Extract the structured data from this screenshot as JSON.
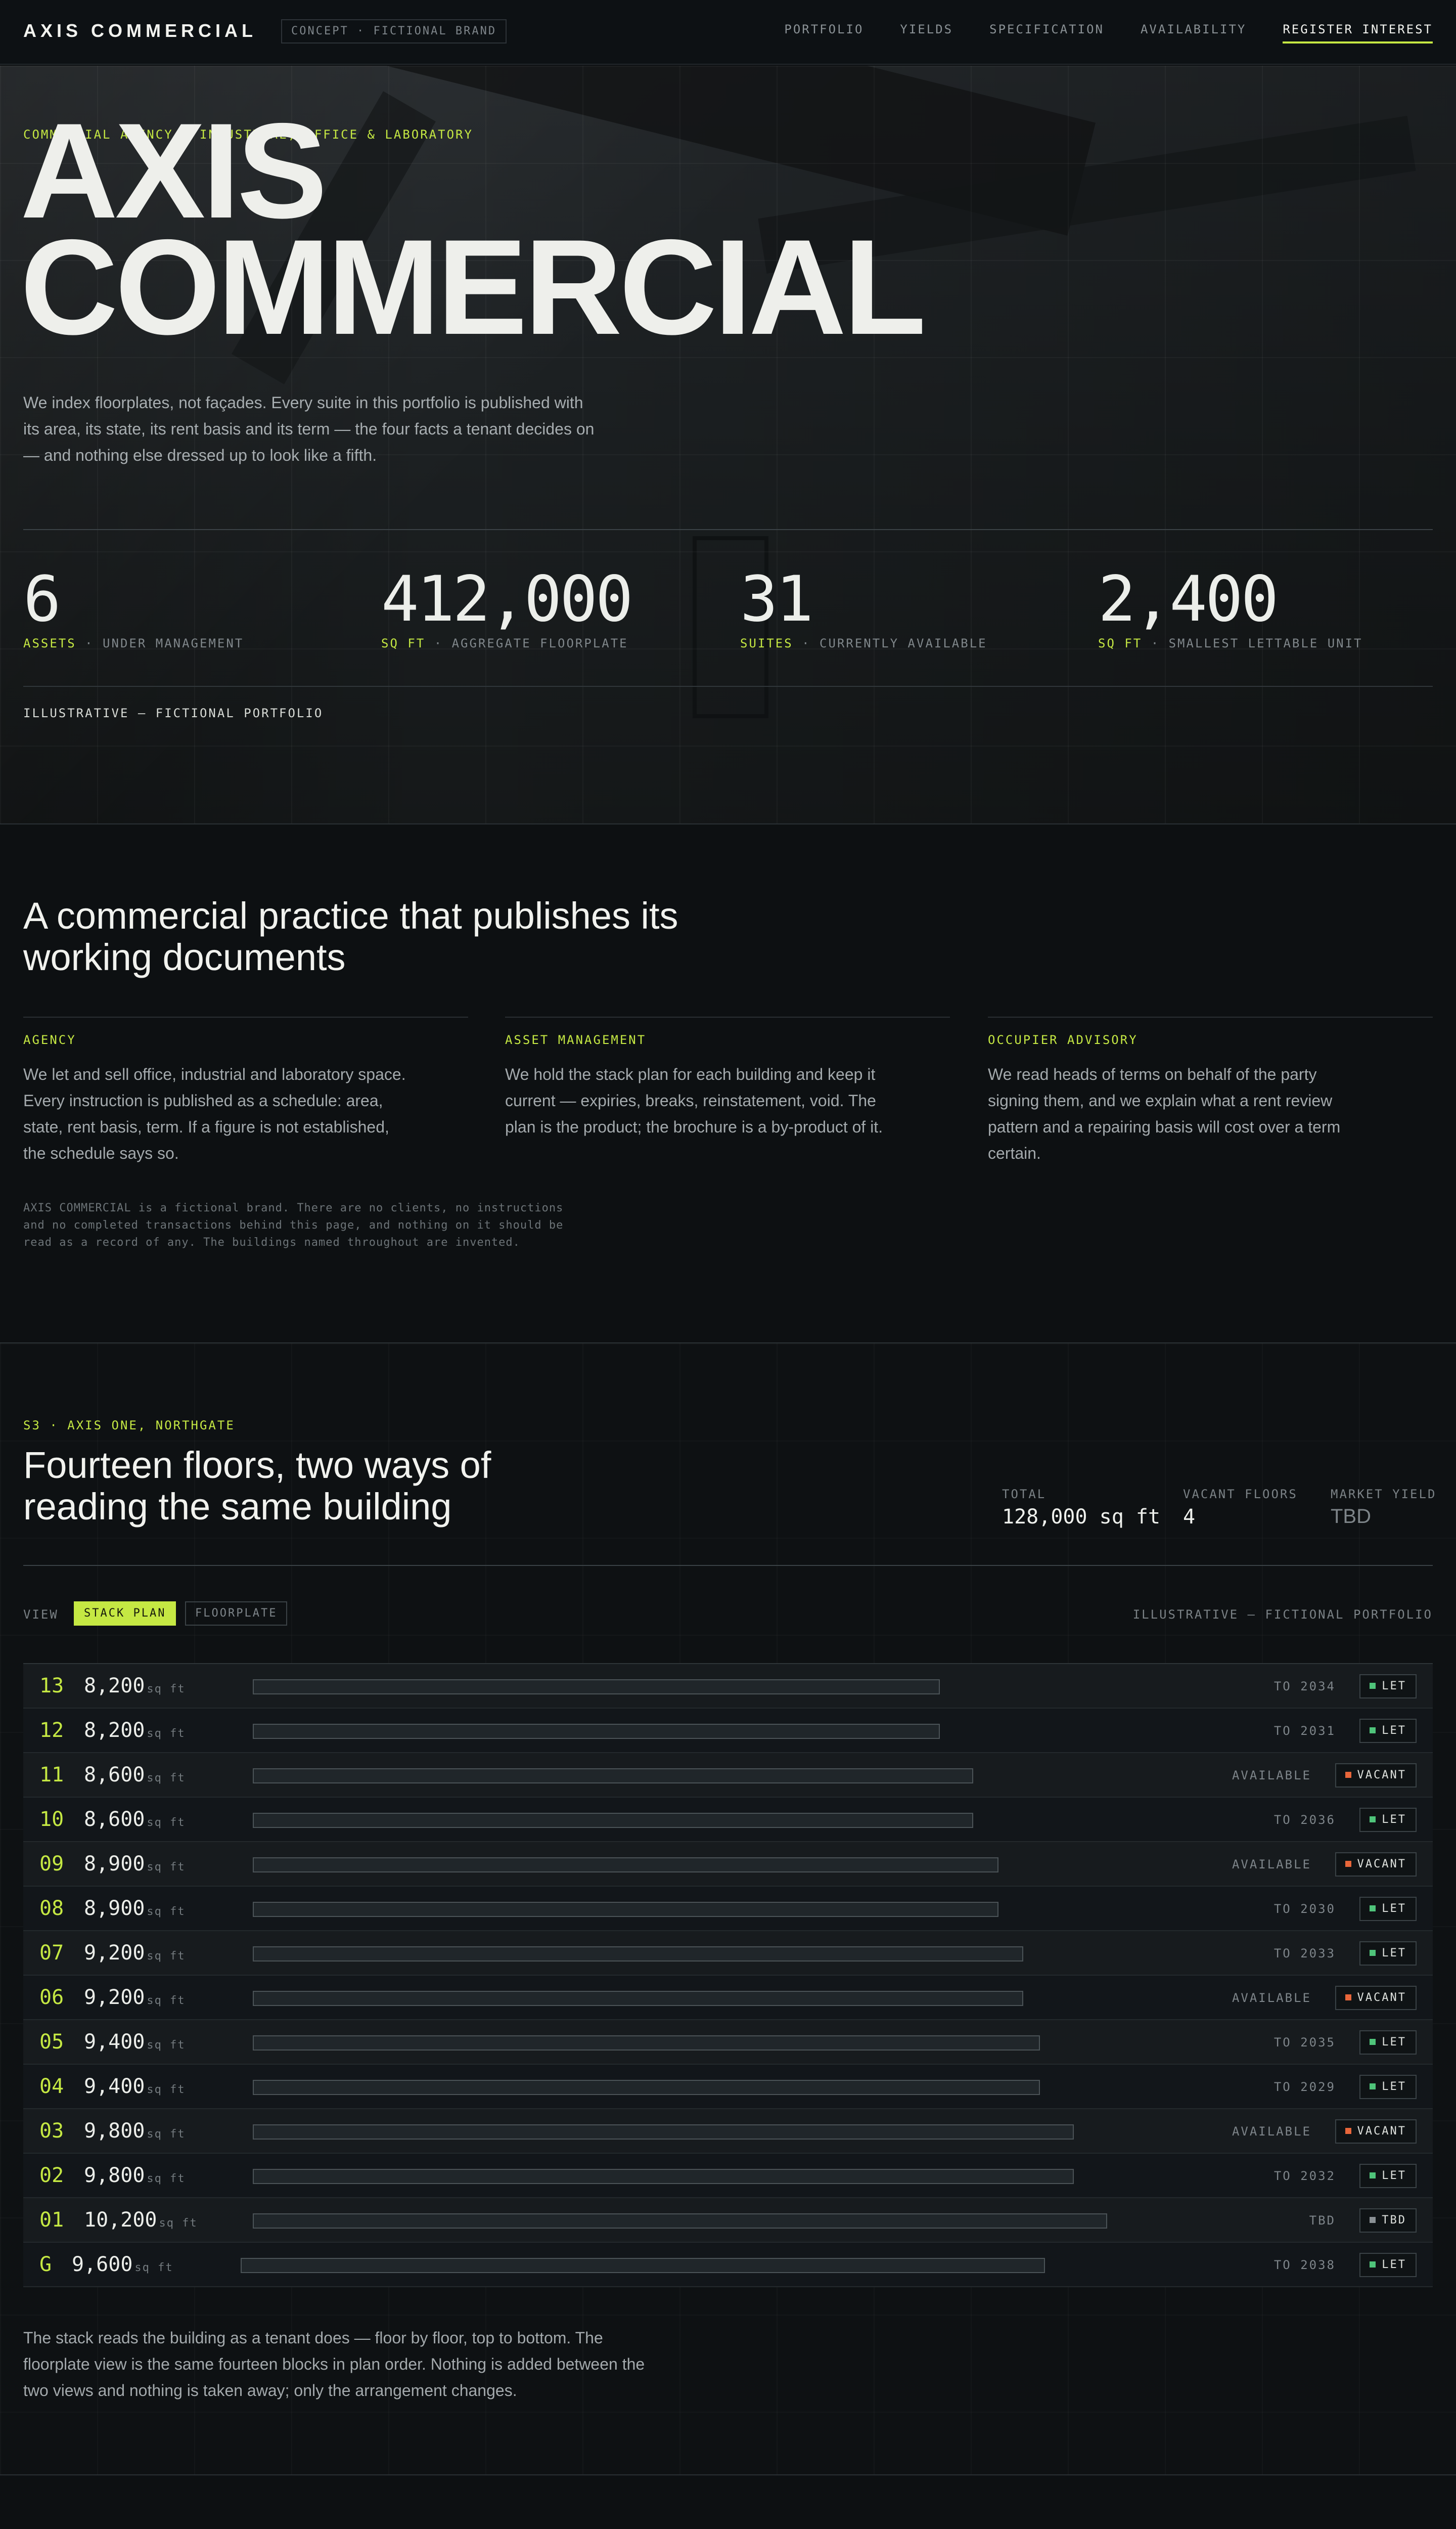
{
  "nav": {
    "brand": "AXIS COMMERCIAL",
    "concept_tag": "CONCEPT · FICTIONAL BRAND",
    "links": [
      "PORTFOLIO",
      "YIELDS",
      "SPECIFICATION",
      "AVAILABILITY"
    ],
    "cta": "REGISTER INTEREST"
  },
  "hero": {
    "eyebrow": "COMMERCIAL AGENCY · INDUSTRIAL, OFFICE & LABORATORY",
    "title_line1": "AXIS",
    "title_line2": "COMMERCIAL",
    "intro": "We index floorplates, not façades. Every suite in this portfolio is published with its area, its state, its rent basis and its term — the four facts a tenant decides on — and nothing else dressed up to look like a fifth.",
    "stats": [
      {
        "value": "6",
        "unit": "ASSETS",
        "label": "· UNDER MANAGEMENT"
      },
      {
        "value": "412,000",
        "unit": "SQ FT",
        "label": "· AGGREGATE FLOORPLATE"
      },
      {
        "value": "31",
        "unit": "SUITES",
        "label": "· CURRENTLY AVAILABLE"
      },
      {
        "value": "2,400",
        "unit": "SQ FT",
        "label": "· SMALLEST LETTABLE UNIT"
      }
    ],
    "note": "ILLUSTRATIVE — FICTIONAL PORTFOLIO"
  },
  "practice": {
    "heading": "A commercial practice that publishes its working documents",
    "columns": [
      {
        "title": "AGENCY",
        "text": "We let and sell office, industrial and laboratory space. Every instruction is published as a schedule: area, state, rent basis, term. If a figure is not established, the schedule says so."
      },
      {
        "title": "ASSET MANAGEMENT",
        "text": "We hold the stack plan for each building and keep it current — expiries, breaks, reinstatement, void. The plan is the product; the brochure is a by-product of it."
      },
      {
        "title": "OCCUPIER ADVISORY",
        "text": "We read heads of terms on behalf of the party signing them, and we explain what a rent review pattern and a repairing basis will cost over a term certain."
      }
    ],
    "disclaimer": "AXIS COMMERCIAL is a fictional brand. There are no clients, no instructions and no completed transactions behind this page, and nothing on it should be read as a record of any. The buildings named throughout are invented."
  },
  "stack": {
    "eyebrow": "S3 · AXIS ONE, NORTHGATE",
    "heading": "Fourteen floors, two ways of reading the same building",
    "meta": [
      {
        "key": "TOTAL",
        "value": "128,000 sq ft"
      },
      {
        "key": "VACANT FLOORS",
        "value": "4"
      },
      {
        "key": "MARKET YIELD",
        "value": "TBD"
      }
    ],
    "view_label": "VIEW",
    "view_active": "STACK PLAN",
    "view_other": "FLOORPLATE",
    "illustrative": "ILLUSTRATIVE — FICTIONAL PORTFOLIO",
    "area_unit": "sq ft",
    "floors": [
      {
        "floor": "13",
        "area": "8,200",
        "area_num": 8200,
        "term": "TO 2034",
        "status": "LET"
      },
      {
        "floor": "12",
        "area": "8,200",
        "area_num": 8200,
        "term": "TO 2031",
        "status": "LET"
      },
      {
        "floor": "11",
        "area": "8,600",
        "area_num": 8600,
        "term": "AVAILABLE",
        "status": "VACANT"
      },
      {
        "floor": "10",
        "area": "8,600",
        "area_num": 8600,
        "term": "TO 2036",
        "status": "LET"
      },
      {
        "floor": "09",
        "area": "8,900",
        "area_num": 8900,
        "term": "AVAILABLE",
        "status": "VACANT"
      },
      {
        "floor": "08",
        "area": "8,900",
        "area_num": 8900,
        "term": "TO 2030",
        "status": "LET"
      },
      {
        "floor": "07",
        "area": "9,200",
        "area_num": 9200,
        "term": "TO 2033",
        "status": "LET"
      },
      {
        "floor": "06",
        "area": "9,200",
        "area_num": 9200,
        "term": "AVAILABLE",
        "status": "VACANT"
      },
      {
        "floor": "05",
        "area": "9,400",
        "area_num": 9400,
        "term": "TO 2035",
        "status": "LET"
      },
      {
        "floor": "04",
        "area": "9,400",
        "area_num": 9400,
        "term": "TO 2029",
        "status": "LET"
      },
      {
        "floor": "03",
        "area": "9,800",
        "area_num": 9800,
        "term": "AVAILABLE",
        "status": "VACANT"
      },
      {
        "floor": "02",
        "area": "9,800",
        "area_num": 9800,
        "term": "TO 2032",
        "status": "LET"
      },
      {
        "floor": "01",
        "area": "10,200",
        "area_num": 10200,
        "term": "TBD",
        "status": "TBD"
      },
      {
        "floor": "G",
        "area": "9,600",
        "area_num": 9600,
        "term": "TO 2038",
        "status": "LET"
      }
    ],
    "status_colors": {
      "LET": "#4fc47a",
      "VACANT": "#e8663a",
      "TBD": "#8a9094"
    },
    "note": "The stack reads the building as a tenant does — floor by floor, top to bottom. The floorplate view is the same fourteen blocks in plan order. Nothing is added between the two views and nothing is taken away; only the arrangement changes."
  }
}
